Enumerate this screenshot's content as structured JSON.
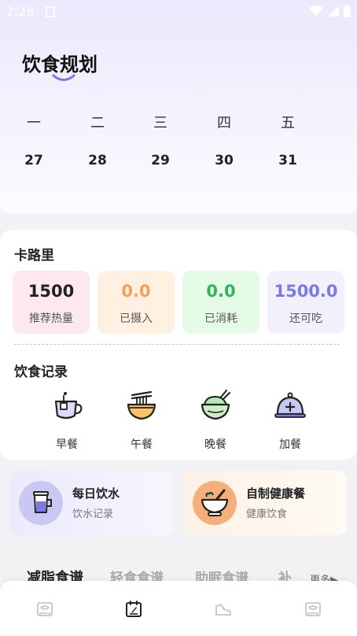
{
  "status": {
    "time": "2:28"
  },
  "page": {
    "title": "饮食规划"
  },
  "week": {
    "days": [
      {
        "name": "一",
        "num": "27"
      },
      {
        "name": "二",
        "num": "28"
      },
      {
        "name": "三",
        "num": "29"
      },
      {
        "name": "四",
        "num": "30"
      },
      {
        "name": "五",
        "num": "31"
      }
    ]
  },
  "calorie": {
    "title": "卡路里",
    "stats": [
      {
        "value": "1500",
        "label": "推荐热量",
        "color": "#222222",
        "bg": "#fde8f2"
      },
      {
        "value": "0.0",
        "label": "已摄入",
        "color": "#f5a05a",
        "bg": "#fff1e1"
      },
      {
        "value": "0.0",
        "label": "已消耗",
        "color": "#2fb55a",
        "bg": "#e6fbe6"
      },
      {
        "value": "1500.0",
        "label": "还可吃",
        "color": "#7a79e6",
        "bg": "#f1f0fc"
      }
    ]
  },
  "records": {
    "title": "饮食记录",
    "meals": [
      {
        "label": "早餐",
        "icon": "tea-cup-icon"
      },
      {
        "label": "午餐",
        "icon": "noodle-bowl-icon"
      },
      {
        "label": "晚餐",
        "icon": "rice-bowl-icon"
      },
      {
        "label": "加餐",
        "icon": "food-cloche-icon"
      }
    ]
  },
  "features": [
    {
      "title": "每日饮水",
      "sub": "饮水记录",
      "icon": "water-cup-icon"
    },
    {
      "title": "自制健康餐",
      "sub": "健康饮食",
      "icon": "mortar-bowl-icon"
    }
  ],
  "tabs": [
    "减脂食谱",
    "轻食食谱",
    "助眠食谱",
    "补"
  ],
  "more": "更多",
  "nav": [
    "home-icon",
    "plan-icon",
    "sport-shoe-icon",
    "profile-icon"
  ],
  "colors": {
    "accent": "#7a79e6",
    "icon_fill": "#dcdaf7"
  }
}
